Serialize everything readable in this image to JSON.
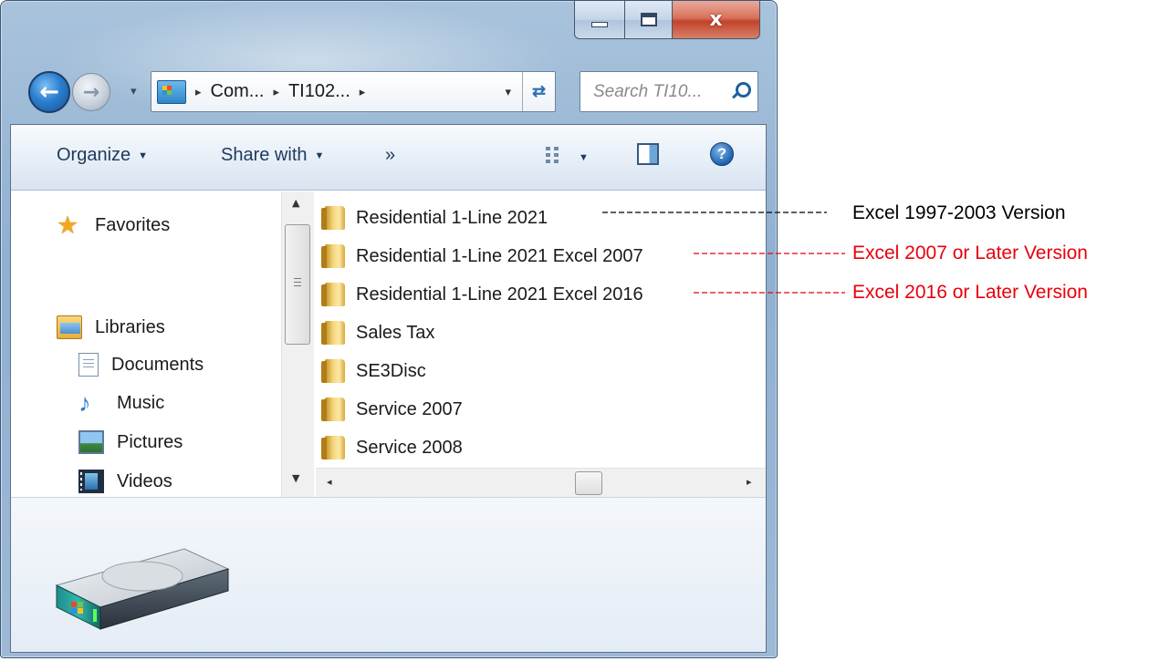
{
  "window": {
    "caption_buttons": {
      "minimize_icon": "minimize-glyph",
      "maximize_icon": "maximize-glyph",
      "close_glyph": "x"
    }
  },
  "navigation": {
    "back_glyph": "←",
    "forward_glyph": "→",
    "history_glyph": "▾",
    "address": {
      "separator": "▸",
      "crumbs": [
        "Com...",
        "TI102..."
      ],
      "dropdown_glyph": "▾",
      "refresh_glyph": "⇄"
    },
    "search": {
      "placeholder": "Search TI10..."
    }
  },
  "toolbar": {
    "organize_label": "Organize",
    "share_label": "Share with",
    "more_label": "»",
    "caret": "▼",
    "help_glyph": "?"
  },
  "nav_pane": {
    "favorites": "Favorites",
    "libraries": "Libraries",
    "library_items": [
      "Documents",
      "Music",
      "Pictures",
      "Videos"
    ],
    "scroll_up": "▲",
    "scroll_down": "▼"
  },
  "file_list": {
    "items": [
      "Residential 1-Line 2021",
      "Residential 1-Line 2021 Excel 2007",
      "Residential 1-Line 2021 Excel 2016",
      "Sales Tax",
      "SE3Disc",
      "Service 2007",
      "Service 2008"
    ],
    "scroll_left": "◂",
    "scroll_right": "▸"
  },
  "annotations": [
    {
      "text": "Excel 1997-2003 Version",
      "color": "#000000"
    },
    {
      "text": "Excel 2007 or Later Version",
      "color": "#e8000b"
    },
    {
      "text": "Excel 2016 or Later Version",
      "color": "#e8000b"
    }
  ]
}
